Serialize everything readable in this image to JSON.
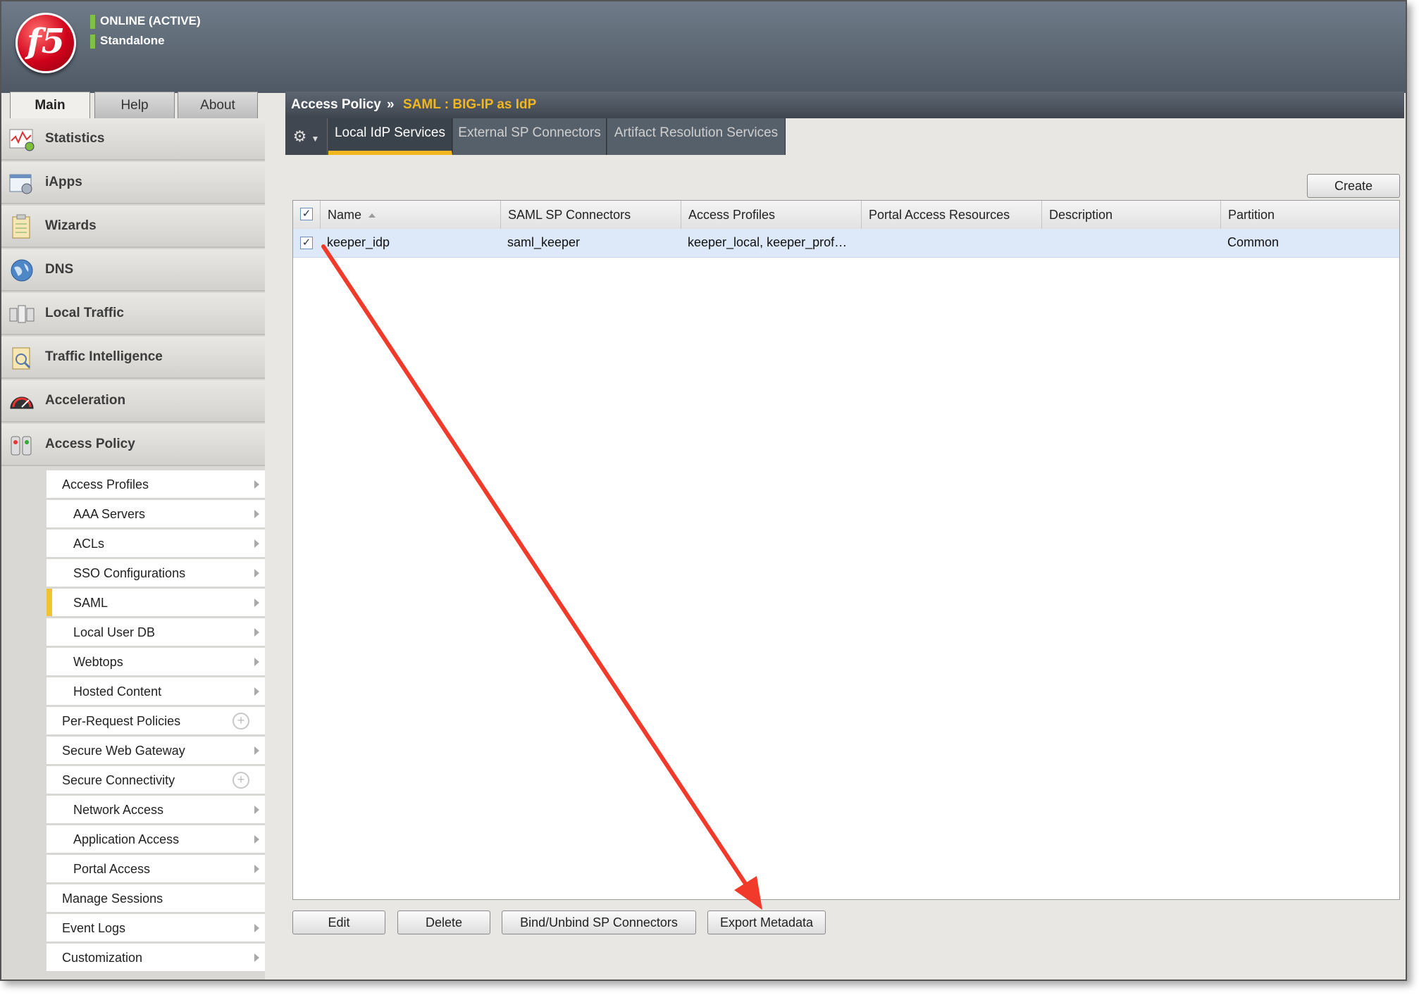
{
  "status": {
    "line1": "ONLINE (ACTIVE)",
    "line2": "Standalone"
  },
  "logo_text": "f5",
  "main_tabs": [
    "Main",
    "Help",
    "About"
  ],
  "sidebar": {
    "items": [
      "Statistics",
      "iApps",
      "Wizards",
      "DNS",
      "Local Traffic",
      "Traffic Intelligence",
      "Acceleration",
      "Access Policy"
    ],
    "submenu": [
      "Access Profiles",
      "AAA Servers",
      "ACLs",
      "SSO Configurations",
      "SAML",
      "Local User DB",
      "Webtops",
      "Hosted Content",
      "Per-Request Policies",
      "Secure Web Gateway",
      "Secure Connectivity",
      "Network Access",
      "Application Access",
      "Portal Access",
      "Manage Sessions",
      "Event Logs",
      "Customization"
    ]
  },
  "breadcrumb": {
    "section": "Access Policy",
    "separator": "»",
    "page": "SAML : BIG-IP as IdP"
  },
  "subtabs": [
    "Local IdP Services",
    "External SP Connectors",
    "Artifact Resolution Services"
  ],
  "create_label": "Create",
  "table": {
    "headers": [
      "Name",
      "SAML SP Connectors",
      "Access Profiles",
      "Portal Access Resources",
      "Description",
      "Partition"
    ],
    "rows": [
      {
        "checked": "✓",
        "name": "keeper_idp",
        "connectors": "saml_keeper",
        "profiles": "keeper_local, keeper_prof…",
        "portal": "",
        "description": "",
        "partition": "Common"
      }
    ],
    "header_check": "✓"
  },
  "actions": [
    "Edit",
    "Delete",
    "Bind/Unbind SP Connectors",
    "Export Metadata"
  ],
  "colors": {
    "accent": "#f2b61f",
    "annotation_arrow": "#f23a2a",
    "status_green": "#7fc241"
  }
}
